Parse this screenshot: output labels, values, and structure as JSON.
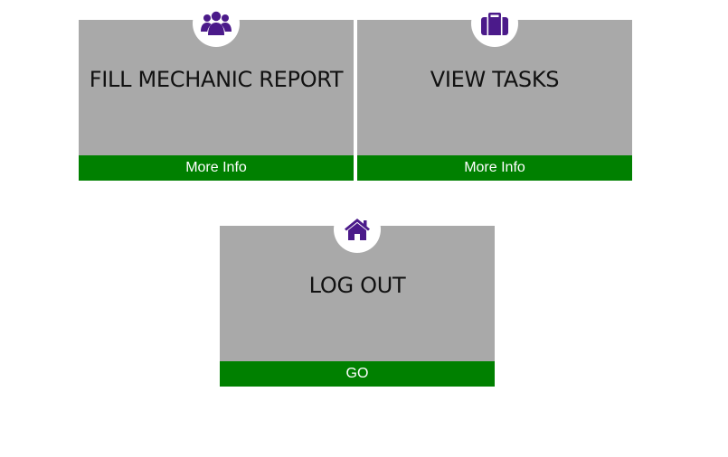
{
  "theme": {
    "card_background": "#a9a9a9",
    "button_background": "#008000",
    "icon_color": "#4b1a8a"
  },
  "cards": [
    {
      "title": "FILL MECHANIC REPORT",
      "icon": "users-icon",
      "button_label": "More Info"
    },
    {
      "title": "VIEW TASKS",
      "icon": "briefcase-icon",
      "button_label": "More Info"
    },
    {
      "title": "LOG OUT",
      "icon": "home-icon",
      "button_label": "GO"
    }
  ]
}
